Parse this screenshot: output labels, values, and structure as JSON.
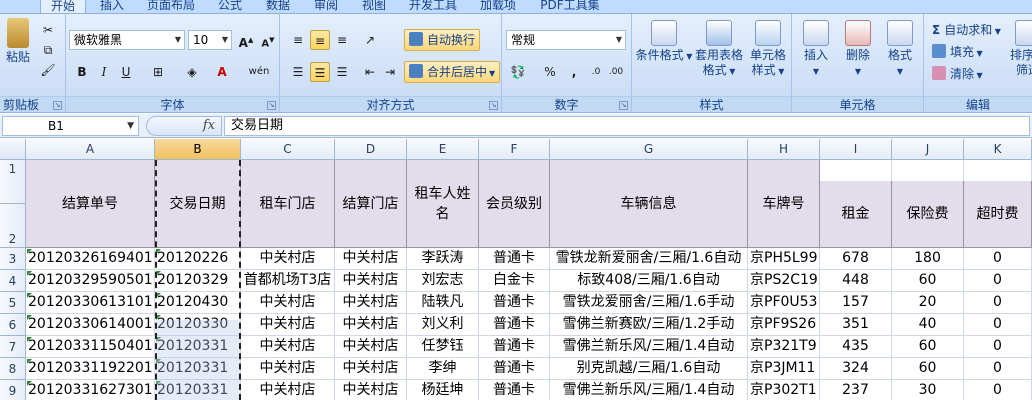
{
  "ribbon_tabs": [
    "开始",
    "插入",
    "页面布局",
    "公式",
    "数据",
    "审阅",
    "视图",
    "开发工具",
    "加载项",
    "PDF工具集"
  ],
  "active_tab": "开始",
  "clipboard": {
    "paste": "粘贴",
    "label": "剪贴板"
  },
  "font": {
    "name": "微软雅黑",
    "size": "10",
    "grow": "A",
    "shrink": "A",
    "bold": "B",
    "italic": "I",
    "underline": "U",
    "font_color": "A",
    "wen": "wén",
    "label": "字体"
  },
  "alignment": {
    "wrap_text": "自动换行",
    "merge_center": "合并后居中",
    "label": "对齐方式"
  },
  "number": {
    "format": "常规",
    "percent": "%",
    "comma": ",",
    "label": "数字"
  },
  "styles": {
    "conditional": "条件格式",
    "table_format": "套用表格格式",
    "cell_styles": "单元格样式",
    "label": "样式"
  },
  "cells": {
    "insert": "插入",
    "delete": "删除",
    "format": "格式",
    "label": "单元格"
  },
  "editing": {
    "autosum": "自动求和",
    "fill": "填充",
    "clear": "清除",
    "sort_filter": "排序和筛选",
    "label": "编辑"
  },
  "formula_bar": {
    "name_box": "B1",
    "fx": "fx",
    "value": "交易日期"
  },
  "columns": [
    "A",
    "B",
    "C",
    "D",
    "E",
    "F",
    "G",
    "H",
    "I",
    "J",
    "K"
  ],
  "row_numbers": [
    "1",
    "2",
    "3",
    "4",
    "5",
    "6",
    "7",
    "8",
    "9"
  ],
  "table": {
    "headers": [
      "结算单号",
      "交易日期",
      "租车门店",
      "结算门店",
      "租车人姓名",
      "会员级别",
      "车辆信息",
      "车牌号",
      "租金",
      "保险费",
      "超时费"
    ],
    "rows": [
      [
        "20120326169401",
        "20120226",
        "中关村店",
        "中关村店",
        "李跃涛",
        "普通卡",
        "雪铁龙新爱丽舍/三厢/1.6自动",
        "京PH5L99",
        "678",
        "180",
        "0"
      ],
      [
        "20120329590501",
        "20120329",
        "首都机场T3店",
        "中关村店",
        "刘宏志",
        "白金卡",
        "标致408/三厢/1.6自动",
        "京PS2C19",
        "448",
        "60",
        "0"
      ],
      [
        "20120330613101",
        "20120430",
        "中关村店",
        "中关村店",
        "陆轶凡",
        "普通卡",
        "雪铁龙爱丽舍/三厢/1.6手动",
        "京PF0U53",
        "157",
        "20",
        "0"
      ],
      [
        "20120330614001",
        "20120330",
        "中关村店",
        "中关村店",
        "刘义利",
        "普通卡",
        "雪佛兰新赛欧/三厢/1.2手动",
        "京PF9S26",
        "351",
        "40",
        "0"
      ],
      [
        "20120331150401",
        "20120331",
        "中关村店",
        "中关村店",
        "任梦钰",
        "普通卡",
        "雪佛兰新乐风/三厢/1.4自动",
        "京P321T9",
        "435",
        "60",
        "0"
      ],
      [
        "20120331192201",
        "20120331",
        "中关村店",
        "中关村店",
        "李绅",
        "普通卡",
        "别克凯越/三厢/1.6自动",
        "京P3JM11",
        "324",
        "60",
        "0"
      ],
      [
        "20120331627301",
        "20120331",
        "中关村店",
        "中关村店",
        "杨廷坤",
        "普通卡",
        "雪佛兰新乐风/三厢/1.4自动",
        "京P302T1",
        "237",
        "30",
        "0"
      ]
    ]
  }
}
